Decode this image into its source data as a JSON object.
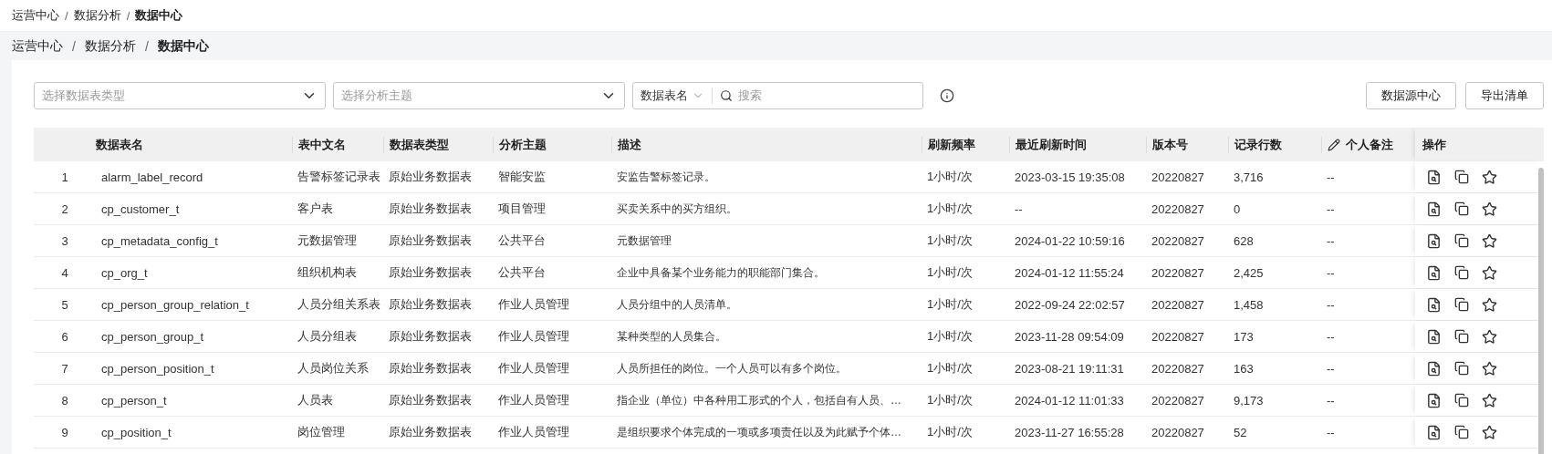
{
  "breadcrumb_separator": "/",
  "top_breadcrumb": [
    {
      "label": "运营中心",
      "current": false
    },
    {
      "label": "数据分析",
      "current": false
    },
    {
      "label": "数据中心",
      "current": true
    }
  ],
  "page_breadcrumb": [
    {
      "label": "运营中心",
      "current": false
    },
    {
      "label": "数据分析",
      "current": false
    },
    {
      "label": "数据中心",
      "current": true
    }
  ],
  "filters": {
    "table_type": {
      "placeholder": "选择数据表类型"
    },
    "topic": {
      "placeholder": "选择分析主题"
    },
    "search_scope": "数据表名",
    "search": {
      "placeholder": "搜索"
    }
  },
  "buttons": [
    "数据源中心",
    "导出清单"
  ],
  "table": {
    "columns": [
      {
        "label": "数据表名",
        "kind": "plain"
      },
      {
        "label": "表中文名",
        "kind": "plain"
      },
      {
        "label": "数据表类型",
        "kind": "plain"
      },
      {
        "label": "分析主题",
        "kind": "plain"
      },
      {
        "label": "描述",
        "kind": "plain"
      },
      {
        "label": "刷新频率",
        "kind": "plain"
      },
      {
        "label": "最近刷新时间",
        "kind": "plain"
      },
      {
        "label": "版本号",
        "kind": "plain"
      },
      {
        "label": "记录行数",
        "kind": "plain"
      },
      {
        "label": "个人备注",
        "kind": "editable"
      },
      {
        "label": "操作",
        "kind": "actions"
      }
    ],
    "rows": [
      {
        "index": "1",
        "name": "alarm_label_record",
        "cn_name": "告警标签记录表",
        "type": "原始业务数据表",
        "topic": "智能安监",
        "description": "安监告警标签记录。",
        "frequency": "1小时/次",
        "refreshed": "2023-03-15 19:35:08",
        "version": "20220827",
        "records": "3,716",
        "note": "--"
      },
      {
        "index": "2",
        "name": "cp_customer_t",
        "cn_name": "客户表",
        "type": "原始业务数据表",
        "topic": "项目管理",
        "description": "买卖关系中的买方组织。",
        "frequency": "1小时/次",
        "refreshed": "--",
        "version": "20220827",
        "records": "0",
        "note": "--"
      },
      {
        "index": "3",
        "name": "cp_metadata_config_t",
        "cn_name": "元数据管理",
        "type": "原始业务数据表",
        "topic": "公共平台",
        "description": "元数据管理",
        "frequency": "1小时/次",
        "refreshed": "2024-01-22 10:59:16",
        "version": "20220827",
        "records": "628",
        "note": "--"
      },
      {
        "index": "4",
        "name": "cp_org_t",
        "cn_name": "组织机构表",
        "type": "原始业务数据表",
        "topic": "公共平台",
        "description": "企业中具备某个业务能力的职能部门集合。",
        "frequency": "1小时/次",
        "refreshed": "2024-01-12 11:55:24",
        "version": "20220827",
        "records": "2,425",
        "note": "--"
      },
      {
        "index": "5",
        "name": "cp_person_group_relation_t",
        "cn_name": "人员分组关系表",
        "type": "原始业务数据表",
        "topic": "作业人员管理",
        "description": "人员分组中的人员清单。",
        "frequency": "1小时/次",
        "refreshed": "2022-09-24 22:02:57",
        "version": "20220827",
        "records": "1,458",
        "note": "--"
      },
      {
        "index": "6",
        "name": "cp_person_group_t",
        "cn_name": "人员分组表",
        "type": "原始业务数据表",
        "topic": "作业人员管理",
        "description": "某种类型的人员集合。",
        "frequency": "1小时/次",
        "refreshed": "2023-11-28 09:54:09",
        "version": "20220827",
        "records": "173",
        "note": "--"
      },
      {
        "index": "7",
        "name": "cp_person_position_t",
        "cn_name": "人员岗位关系",
        "type": "原始业务数据表",
        "topic": "作业人员管理",
        "description": "人员所担任的岗位。一个人员可以有多个岗位。",
        "frequency": "1小时/次",
        "refreshed": "2023-08-21 19:11:31",
        "version": "20220827",
        "records": "163",
        "note": "--"
      },
      {
        "index": "8",
        "name": "cp_person_t",
        "cn_name": "人员表",
        "type": "原始业务数据表",
        "topic": "作业人员管理",
        "description": "指企业（单位）中各种用工形式的个人，包括自有人员、…",
        "frequency": "1小时/次",
        "refreshed": "2024-01-12 11:01:33",
        "version": "20220827",
        "records": "9,173",
        "note": "--"
      },
      {
        "index": "9",
        "name": "cp_position_t",
        "cn_name": "岗位管理",
        "type": "原始业务数据表",
        "topic": "作业人员管理",
        "description": "是组织要求个体完成的一项或多项责任以及为此赋予个体…",
        "frequency": "1小时/次",
        "refreshed": "2023-11-27 16:55:28",
        "version": "20220827",
        "records": "52",
        "note": "--"
      }
    ]
  }
}
